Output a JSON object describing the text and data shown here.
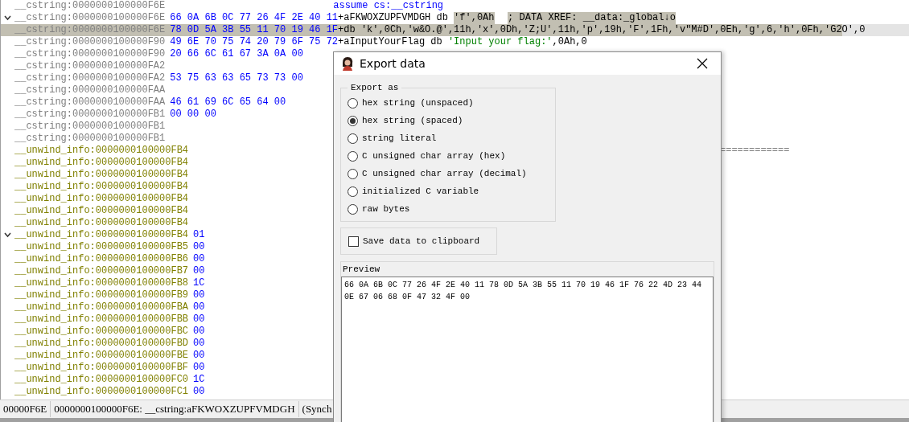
{
  "listing": [
    {
      "address": "__cstring:0000000100000F6E",
      "kind": "cstring",
      "selected": false,
      "code": [
        {
          "text": "assume cs:__cstring",
          "kind": "directive",
          "selected": false
        }
      ]
    },
    {
      "address": "__cstring:0000000100000F6E",
      "kind": "cstring",
      "expanded": true,
      "selected": false,
      "hex": "66 0A 6B 0C 77 26 4F 2E 40 11",
      "code": [
        {
          "text": "+aFKWOXZUPFVMDGH db ",
          "kind": "plain",
          "selected": false
        },
        {
          "text": "'f',0Ah",
          "kind": "plain",
          "selected": true
        }
      ],
      "comment": {
        "text": "; DATA XREF: __data:_global↓o",
        "selected": true
      }
    },
    {
      "address": "__cstring:0000000100000F6E",
      "kind": "cstring",
      "selected": true,
      "hex": "78 0D 5A 3B 55 11 70 19 46 1F",
      "code": [
        {
          "text": "+db 'k',0Ch,'w&O.@',11h,'x',0Dh,'Z;U',11h,'p',19h,'F',1Fh,'v\"M#D',0Eh,'g',6,'h',0Fh,'G2O',0",
          "kind": "plain",
          "selected": false
        }
      ]
    },
    {
      "address": "__cstring:0000000100000F90",
      "kind": "cstring",
      "selected": false,
      "hex": "49 6E 70 75 74 20 79 6F 75 72",
      "code": [
        {
          "text": "+aInputYourFlag db ",
          "kind": "plain",
          "selected": false
        },
        {
          "text": "'Input your flag:'",
          "kind": "string",
          "selected": false
        },
        {
          "text": ",0Ah,0",
          "kind": "plain",
          "selected": false
        }
      ]
    },
    {
      "address": "__cstring:0000000100000F90",
      "kind": "cstring",
      "selected": false,
      "hex": "20 66 6C 61 67 3A 0A 00"
    },
    {
      "address": "__cstring:0000000100000FA2",
      "kind": "cstring",
      "selected": false
    },
    {
      "address": "__cstring:0000000100000FA2",
      "kind": "cstring",
      "selected": false,
      "hex": "53 75 63 63 65 73 73 00"
    },
    {
      "address": "__cstring:0000000100000FAA",
      "kind": "cstring",
      "selected": false
    },
    {
      "address": "__cstring:0000000100000FAA",
      "kind": "cstring",
      "selected": false,
      "hex": "46 61 69 6C 65 64 00"
    },
    {
      "address": "__cstring:0000000100000FB1",
      "kind": "cstring",
      "selected": false,
      "hex": "00 00 00"
    },
    {
      "address": "__cstring:0000000100000FB1",
      "kind": "cstring",
      "selected": false
    },
    {
      "address": "__cstring:0000000100000FB1",
      "kind": "cstring",
      "selected": false
    },
    {
      "address": "__unwind_info:0000000100000FB4",
      "kind": "unwind",
      "selected": false,
      "tail": "============"
    },
    {
      "address": "__unwind_info:0000000100000FB4",
      "kind": "unwind",
      "selected": false
    },
    {
      "address": "__unwind_info:0000000100000FB4",
      "kind": "unwind",
      "selected": false
    },
    {
      "address": "__unwind_info:0000000100000FB4",
      "kind": "unwind",
      "selected": false
    },
    {
      "address": "__unwind_info:0000000100000FB4",
      "kind": "unwind",
      "selected": false
    },
    {
      "address": "__unwind_info:0000000100000FB4",
      "kind": "unwind",
      "selected": false
    },
    {
      "address": "__unwind_info:0000000100000FB4",
      "kind": "unwind",
      "selected": false
    },
    {
      "address": "__unwind_info:0000000100000FB4",
      "kind": "unwind",
      "expanded": true,
      "selected": false,
      "hex": "01"
    },
    {
      "address": "__unwind_info:0000000100000FB5",
      "kind": "unwind",
      "selected": false,
      "hex": "00"
    },
    {
      "address": "__unwind_info:0000000100000FB6",
      "kind": "unwind",
      "selected": false,
      "hex": "00"
    },
    {
      "address": "__unwind_info:0000000100000FB7",
      "kind": "unwind",
      "selected": false,
      "hex": "00"
    },
    {
      "address": "__unwind_info:0000000100000FB8",
      "kind": "unwind",
      "selected": false,
      "hex": "1C"
    },
    {
      "address": "__unwind_info:0000000100000FB9",
      "kind": "unwind",
      "selected": false,
      "hex": "00"
    },
    {
      "address": "__unwind_info:0000000100000FBA",
      "kind": "unwind",
      "selected": false,
      "hex": "00"
    },
    {
      "address": "__unwind_info:0000000100000FBB",
      "kind": "unwind",
      "selected": false,
      "hex": "00"
    },
    {
      "address": "__unwind_info:0000000100000FBC",
      "kind": "unwind",
      "selected": false,
      "hex": "00"
    },
    {
      "address": "__unwind_info:0000000100000FBD",
      "kind": "unwind",
      "selected": false,
      "hex": "00"
    },
    {
      "address": "__unwind_info:0000000100000FBE",
      "kind": "unwind",
      "selected": false,
      "hex": "00"
    },
    {
      "address": "__unwind_info:0000000100000FBF",
      "kind": "unwind",
      "selected": false,
      "hex": "00"
    },
    {
      "address": "__unwind_info:0000000100000FC0",
      "kind": "unwind",
      "selected": false,
      "hex": "1C"
    },
    {
      "address": "__unwind_info:0000000100000FC1",
      "kind": "unwind",
      "selected": false,
      "hex": "00"
    }
  ],
  "status_bar": [
    "00000F6E",
    "0000000100000F6E: __cstring:aFKWOXZUPFVMDGH",
    "(Synch"
  ],
  "dialog": {
    "title": "Export data",
    "export_as": {
      "label": "Export as",
      "options": [
        {
          "label": "hex string (unspaced)",
          "selected": false
        },
        {
          "label": "hex string (spaced)",
          "selected": true
        },
        {
          "label": "string literal",
          "selected": false
        },
        {
          "label": "C unsigned char array (hex)",
          "selected": false
        },
        {
          "label": "C unsigned char array (decimal)",
          "selected": false
        },
        {
          "label": "initialized C variable",
          "selected": false
        },
        {
          "label": "raw bytes",
          "selected": false
        }
      ]
    },
    "save_to_clipboard": {
      "label": "Save data to clipboard",
      "checked": false
    },
    "preview": {
      "label": "Preview",
      "value": "66 0A 6B 0C 77 26 4F 2E 40 11 78 0D 5A 3B 55 11 70 19 46 1F 76 22 4D 23 44 0E 67 06 68 0F 47 32 4F 00"
    }
  }
}
